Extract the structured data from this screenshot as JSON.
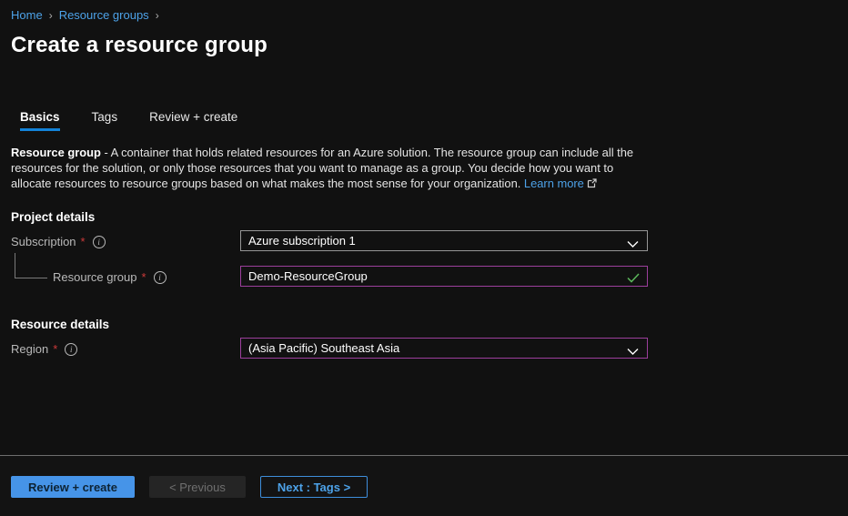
{
  "breadcrumb": {
    "separator": "›",
    "items": [
      {
        "label": "Home"
      },
      {
        "label": "Resource groups"
      }
    ]
  },
  "page": {
    "title": "Create a resource group"
  },
  "tabs": [
    {
      "label": "Basics",
      "active": true
    },
    {
      "label": "Tags",
      "active": false
    },
    {
      "label": "Review + create",
      "active": false
    }
  ],
  "description": {
    "lead": "Resource group",
    "body": " - A container that holds related resources for an Azure solution. The resource group can include all the resources for the solution, or only those resources that you want to manage as a group. You decide how you want to allocate resources to resource groups based on what makes the most sense for your organization.",
    "learn_more": "Learn more"
  },
  "sections": {
    "project_details": {
      "heading": "Project details",
      "subscription": {
        "label": "Subscription",
        "required_mark": "*",
        "value": "Azure subscription 1",
        "control": "dropdown"
      },
      "resource_group": {
        "label": "Resource group",
        "required_mark": "*",
        "value": "Demo-ResourceGroup",
        "control": "text-input",
        "validation": "valid"
      }
    },
    "resource_details": {
      "heading": "Resource details",
      "region": {
        "label": "Region",
        "required_mark": "*",
        "value": "(Asia Pacific) Southeast Asia",
        "control": "dropdown"
      }
    }
  },
  "footer": {
    "review_create_label": "Review + create",
    "previous_label": "< Previous",
    "next_label": "Next : Tags >"
  },
  "icons": {
    "info": "info-circle",
    "chevron_down": "chevron-down",
    "valid_check": "green-check",
    "external_link": "external-link"
  },
  "colors": {
    "background": "#111111",
    "footer_background": "#131313",
    "link_blue": "#4da2e8",
    "tab_underline_blue": "#1383d8",
    "focus_purple_border": "#9c3f9c",
    "neutral_border": "#969696",
    "valid_green": "#5cb85c",
    "required_red": "#cd3a3a",
    "primary_button_blue": "#4694e8"
  }
}
